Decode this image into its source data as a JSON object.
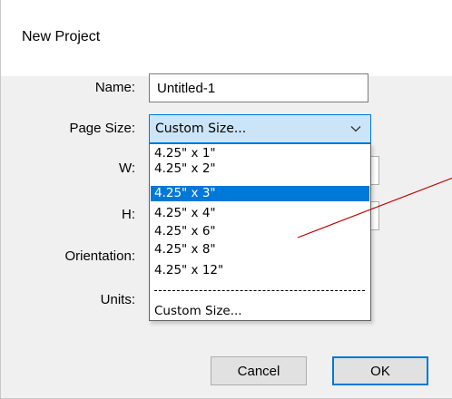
{
  "window": {
    "title": "New Project"
  },
  "form": {
    "name_label": "Name:",
    "name_value": "Untitled-1",
    "page_size_label": "Page Size:",
    "page_size_value": "Custom Size...",
    "width_label": "W:",
    "height_label": "H:",
    "orientation_label": "Orientation:",
    "units_label": "Units:"
  },
  "page_size_options": [
    {
      "label": "4.25\" x 1\"",
      "selected": false
    },
    {
      "label": "4.25\" x 2\"",
      "selected": false
    },
    {
      "label": "4.25\" x 3\"",
      "selected": true
    },
    {
      "label": "4.25\" x 4\"",
      "selected": false
    },
    {
      "label": "4.25\" x 6\"",
      "selected": false
    },
    {
      "label": "4.25\" x 8\"",
      "selected": false
    },
    {
      "label": "4.25\" x 12\"",
      "selected": false
    },
    {
      "label": "Custom Size...",
      "selected": false
    }
  ],
  "buttons": {
    "cancel": "Cancel",
    "ok": "OK"
  },
  "colors": {
    "accent": "#0078d7",
    "annotation_line": "#c00000"
  },
  "icons": {
    "dropdown_arrow": "chevron-down-icon"
  }
}
